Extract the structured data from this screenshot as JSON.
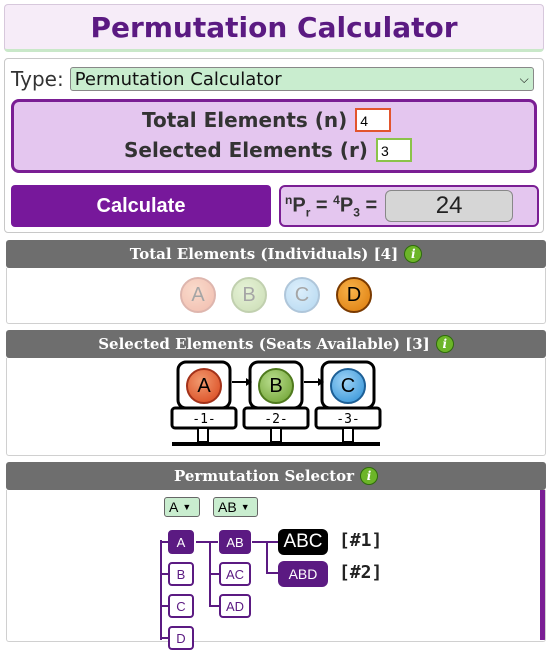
{
  "title": "Permutation Calculator",
  "type_label": "Type:",
  "type_value": "Permutation Calculator",
  "total_label": "Total Elements (n)",
  "total_value": "4",
  "selected_label": "Selected Elements (r)",
  "selected_value": "3",
  "calculate_label": "Calculate",
  "formula": {
    "n": "n",
    "P": "P",
    "r": "r",
    "eq": "=",
    "nval": "4",
    "rval": "3",
    "eq2": "="
  },
  "result": "24",
  "sections": {
    "total_header": "Total Elements (Individuals) [4]",
    "selected_header": "Selected Elements (Seats Available) [3]",
    "selector_header": "Permutation Selector"
  },
  "individuals": [
    "A",
    "B",
    "C",
    "D"
  ],
  "seats": [
    {
      "ball": "A",
      "label": "-1-"
    },
    {
      "ball": "B",
      "label": "-2-"
    },
    {
      "ball": "C",
      "label": "-3-"
    }
  ],
  "selector": {
    "dd1": "A",
    "dd2": "AB",
    "level1": [
      "A",
      "B",
      "C",
      "D"
    ],
    "level2": [
      "AB",
      "AC",
      "AD"
    ],
    "perms": [
      {
        "label": "ABC",
        "num": "[#1]"
      },
      {
        "label": "ABD",
        "num": "[#2]"
      }
    ]
  },
  "colors": {
    "accent": "#77189b",
    "panel": "#e4c6ef",
    "header": "#6e6e6e",
    "select_bg": "#c9edcf"
  },
  "icons": [
    "info-icon",
    "chevron-down-icon",
    "arrow-right-icon"
  ]
}
